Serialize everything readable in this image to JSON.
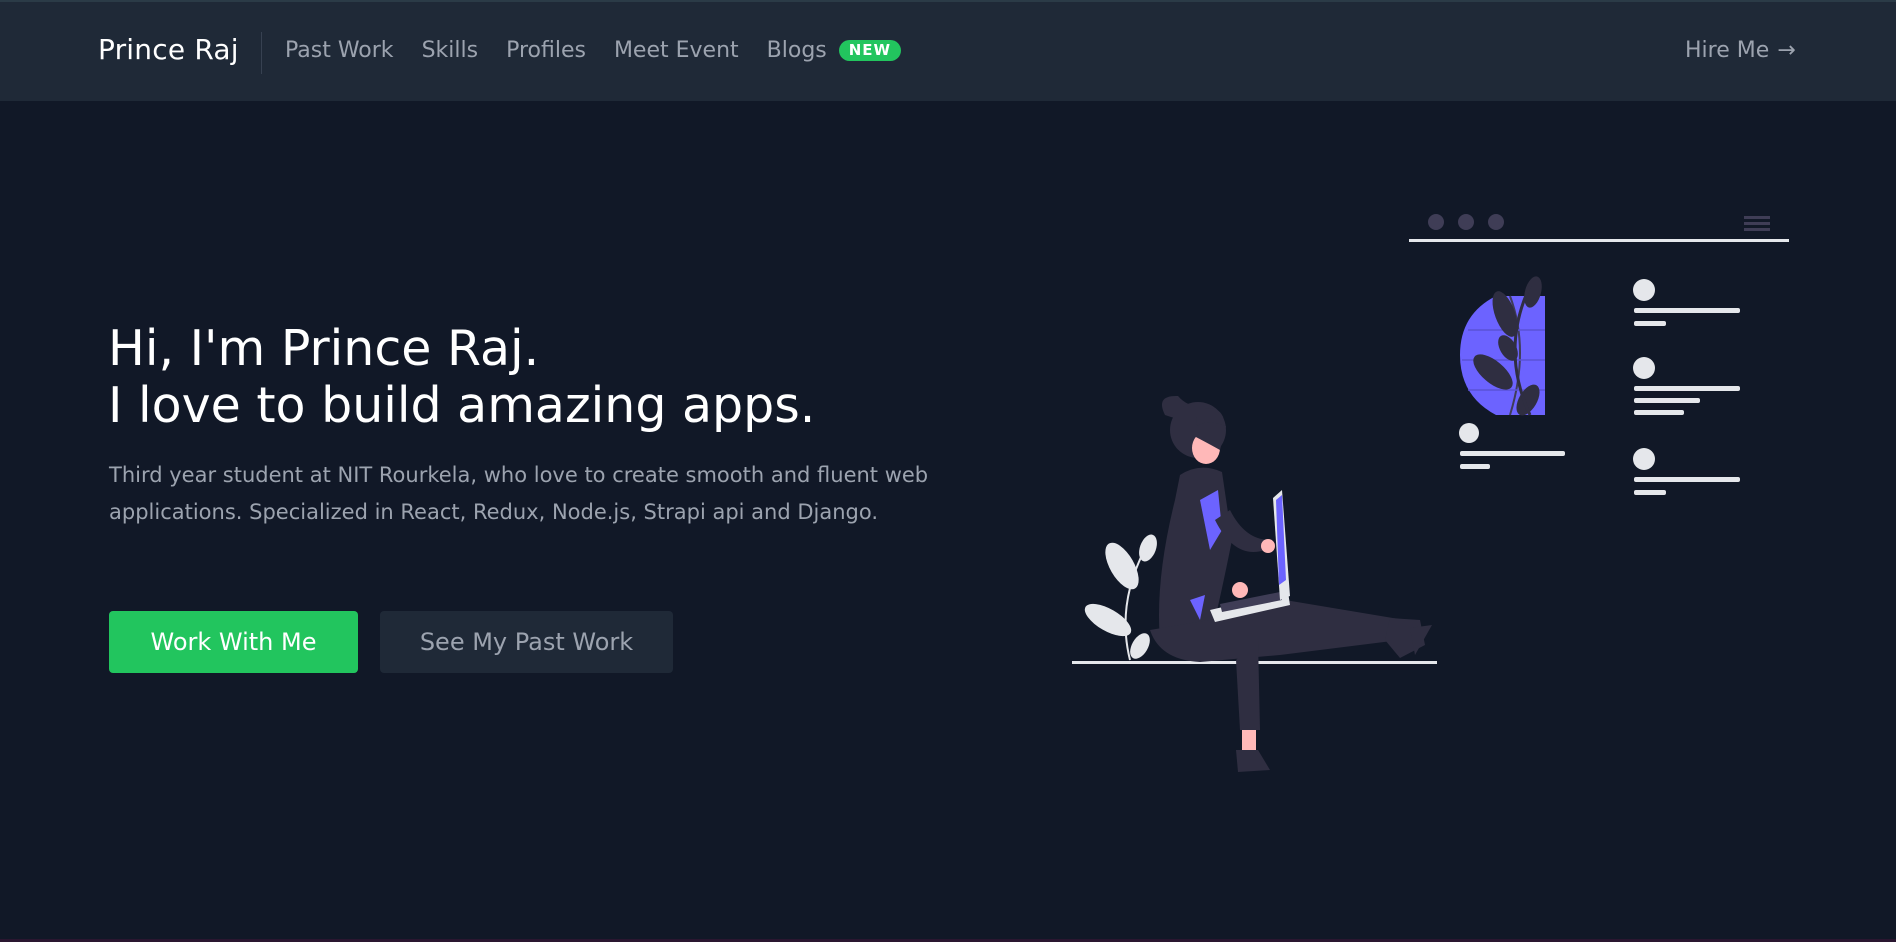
{
  "header": {
    "brand": "Prince Raj",
    "nav": [
      {
        "label": "Past Work"
      },
      {
        "label": "Skills"
      },
      {
        "label": "Profiles"
      },
      {
        "label": "Meet Event"
      },
      {
        "label": "Blogs",
        "badge": "NEW"
      }
    ],
    "hire": {
      "label": "Hire Me",
      "icon": "arrow-right-icon"
    }
  },
  "hero": {
    "title_line1": "Hi, I'm Prince Raj.",
    "title_line2": "I love to build amazing apps.",
    "description": "Third year student at NIT Rourkela, who love to create smooth and fluent web applications. Specialized in React, Redux, Node.js, Strapi api and Django.",
    "primary_button": "Work With Me",
    "secondary_button": "See My Past Work"
  },
  "colors": {
    "background": "#111827",
    "header": "#1f2937",
    "accent": "#22c55e",
    "illustration_accent": "#6c63ff",
    "muted_text": "#9ca3af"
  }
}
